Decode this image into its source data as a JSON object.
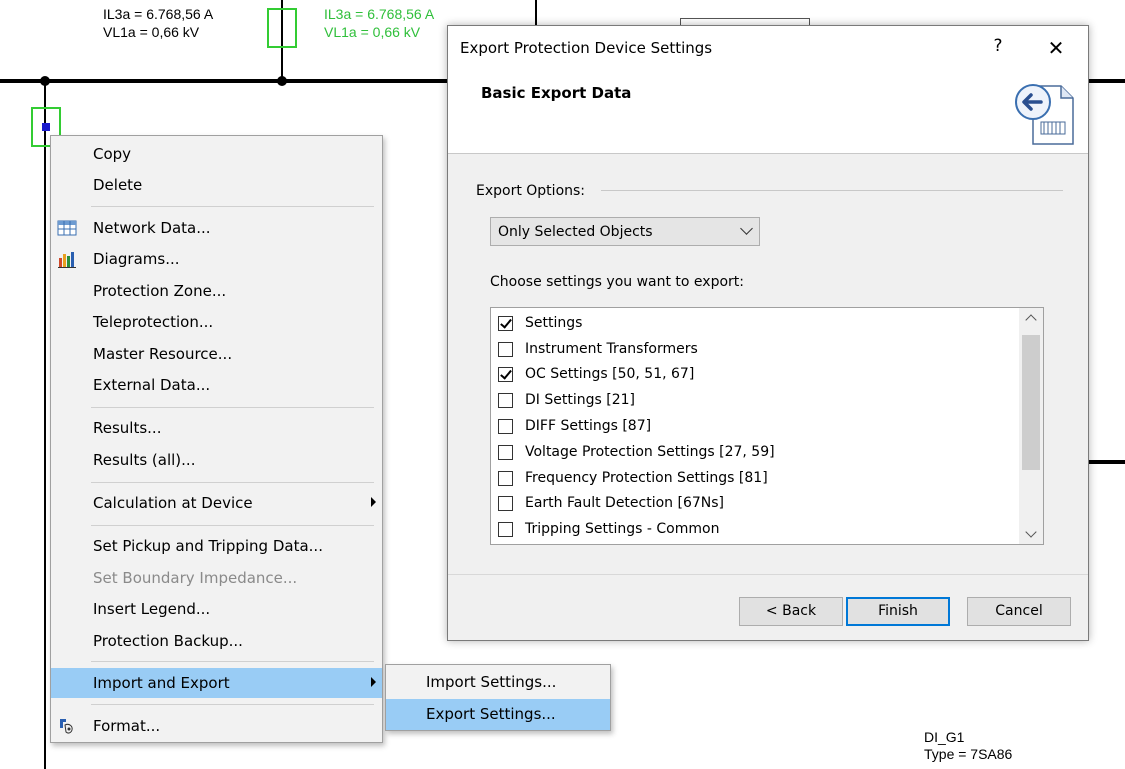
{
  "diagram": {
    "left_current": "IL3a = 6.768,56 A",
    "left_voltage": "VL1a = 0,66 kV",
    "right_current": "IL3a = 6.768,56 A",
    "right_voltage": "VL1a = 0,66 kV",
    "device_name": "DI_G1",
    "device_type": "Type = 7SA86",
    "colors": {
      "green": "#2fbf3a",
      "node_blue": "#1a1acc"
    }
  },
  "context_menu": {
    "items": [
      {
        "label": "Copy"
      },
      {
        "label": "Delete"
      },
      {
        "label": "Network Data...",
        "icon": "table-icon"
      },
      {
        "label": "Diagrams...",
        "icon": "chart-icon"
      },
      {
        "label": "Protection Zone..."
      },
      {
        "label": "Teleprotection..."
      },
      {
        "label": "Master Resource..."
      },
      {
        "label": "External Data..."
      },
      {
        "label": "Results..."
      },
      {
        "label": "Results (all)..."
      },
      {
        "label": "Calculation at Device"
      },
      {
        "label": "Set Pickup and Tripping Data..."
      },
      {
        "label": "Set Boundary Impedance...",
        "disabled": true
      },
      {
        "label": "Insert Legend..."
      },
      {
        "label": "Protection Backup..."
      },
      {
        "label": "Import and Export",
        "highlighted": true
      },
      {
        "label": "Format...",
        "icon": "format-icon"
      }
    ]
  },
  "submenu": {
    "items": [
      {
        "label": "Import Settings..."
      },
      {
        "label": "Export Settings...",
        "highlighted": true
      }
    ]
  },
  "dialog": {
    "title": "Export Protection Device Settings",
    "help_label": "?",
    "close_label": "✕",
    "heading": "Basic Export Data",
    "export_options_label": "Export Options:",
    "export_options_value": "Only Selected Objects",
    "choose_label": "Choose settings you want to export:",
    "settings": [
      {
        "label": "Settings",
        "checked": true
      },
      {
        "label": "Instrument Transformers",
        "checked": false
      },
      {
        "label": "OC Settings [50, 51, 67]",
        "checked": true
      },
      {
        "label": "DI Settings [21]",
        "checked": false
      },
      {
        "label": "DIFF Settings [87]",
        "checked": false
      },
      {
        "label": "Voltage Protection Settings [27, 59]",
        "checked": false
      },
      {
        "label": "Frequency Protection Settings [81]",
        "checked": false
      },
      {
        "label": "Earth Fault Detection [67Ns]",
        "checked": false
      },
      {
        "label": "Tripping Settings - Common",
        "checked": false
      }
    ],
    "buttons": {
      "back": "< Back",
      "finish": "Finish",
      "cancel": "Cancel"
    },
    "colors": {
      "default_button_border": "#0078d7",
      "menu_highlight": "#99ccf5"
    }
  }
}
